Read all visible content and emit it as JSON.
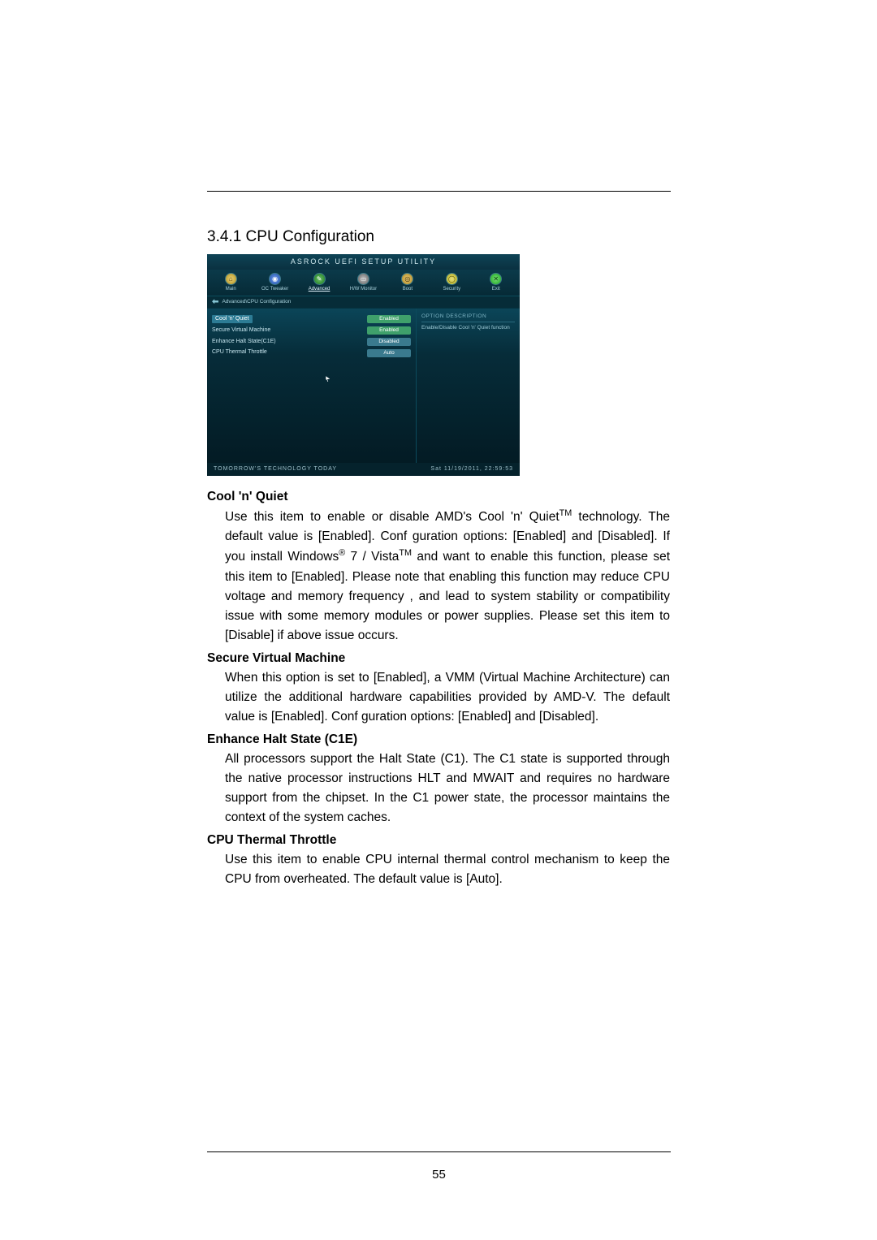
{
  "page_number": "55",
  "section": {
    "number": "3.4.1",
    "title": "CPU Configuration"
  },
  "bios": {
    "window_title": "ASROCK UEFI SETUP UTILITY",
    "nav": [
      {
        "label": "Main"
      },
      {
        "label": "OC Tweaker"
      },
      {
        "label": "Advanced"
      },
      {
        "label": "H/W Monitor"
      },
      {
        "label": "Boot"
      },
      {
        "label": "Security"
      },
      {
        "label": "Exit"
      }
    ],
    "breadcrumb": "Advanced\\CPU Configuration",
    "options": [
      {
        "label": "Cool 'n' Quiet",
        "value": "Enabled",
        "vclass": "v-enabled",
        "selected": true
      },
      {
        "label": "Secure Virtual Machine",
        "value": "Enabled",
        "vclass": "v-enabled"
      },
      {
        "label": "Enhance Halt State(C1E)",
        "value": "Disabled",
        "vclass": "v-disabled"
      },
      {
        "label": "CPU Thermal Throttle",
        "value": "Auto",
        "vclass": "v-auto"
      }
    ],
    "hint_title": "OPTION  DESCRIPTION",
    "hint_body": "Enable/Disable Cool 'n' Quiet function",
    "footer_left": "TOMORROW'S TECHNOLOGY TODAY",
    "footer_right": "Sat  11/19/2011,  22:59:53"
  },
  "items": [
    {
      "title": "Cool 'n' Quiet",
      "body_html": "Use this item to enable or disable AMD's Cool 'n' Quiet<sup>TM</sup> technology. The default value is [Enabled]. Conf guration options: [Enabled] and [Disabled]. If you install Windows<sup>®</sup> 7 / Vista<sup>TM</sup> and want to enable this function, please set this item to [Enabled]. Please note that enabling this function may reduce CPU voltage and memory frequency , and lead to system stability or compatibility issue with some memory modules or power supplies. Please set this item to [Disable] if above issue occurs."
    },
    {
      "title": "Secure Virtual Machine",
      "body_html": " When this option is set to [Enabled], a VMM (Virtual Machine Architecture) can utilize the additional hardware capabilities provided by AMD-V. The default value is [Enabled]. Conf guration options: [Enabled] and [Disabled]."
    },
    {
      "title": "Enhance Halt State (C1E)",
      "body_html": "All processors support the Halt State (C1). The C1 state is supported through the native processor instructions HLT and MWAIT and requires no hardware support from the chipset. In the C1 power state, the processor maintains the context of the system caches."
    },
    {
      "title": "CPU Thermal Throttle",
      "body_html": "Use this item to enable CPU internal thermal control mechanism to keep the CPU from overheated. The default value is [Auto]."
    }
  ]
}
